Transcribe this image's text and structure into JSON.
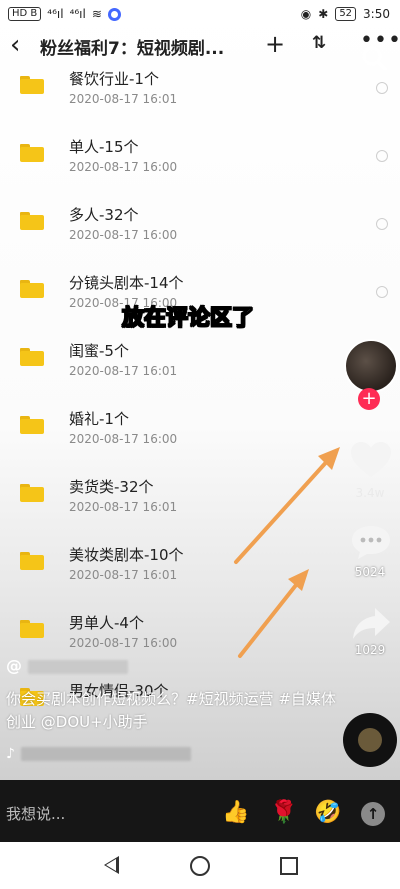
{
  "status_bar": {
    "left_items": [
      "HD B",
      "⁴⁶ıl",
      "⁴⁶ıl",
      "≋"
    ],
    "battery": "52",
    "time": "3:50"
  },
  "app_bar": {
    "title": "粉丝福利7：短视频剧...",
    "plus": "+",
    "sort": "⇅",
    "more": "•••"
  },
  "files": [
    {
      "name": "餐饮行业-1个",
      "date": "2020-08-17  16:01"
    },
    {
      "name": "单人-15个",
      "date": "2020-08-17  16:00"
    },
    {
      "name": "多人-32个",
      "date": "2020-08-17  16:00"
    },
    {
      "name": "分镜头剧本-14个",
      "date": "2020-08-17  16:00"
    },
    {
      "name": "闺蜜-5个",
      "date": "2020-08-17  16:01"
    },
    {
      "name": "婚礼-1个",
      "date": "2020-08-17  16:00"
    },
    {
      "name": "卖货类-32个",
      "date": "2020-08-17  16:01"
    },
    {
      "name": "美妆类剧本-10个",
      "date": "2020-08-17  16:01"
    },
    {
      "name": "男单人-4个",
      "date": "2020-08-17  16:00"
    },
    {
      "name": "男女情侣-30个",
      "date": ""
    }
  ],
  "overlay_caption": "放在评论区了",
  "rail": {
    "follow": "+",
    "like_count": "3.4w",
    "comment_count": "5024",
    "share_count": "1029"
  },
  "video_info": {
    "author_prefix": "@",
    "description": "你会买剧本创作短视频么？#短视频运营 #自媒体创业 @DOU+小助手",
    "music_prefix": "♪"
  },
  "comment_bar": {
    "placeholder": "我想说...",
    "emojis": [
      "👍",
      "🌹",
      "🤣"
    ],
    "send": "↑"
  },
  "colors": {
    "folder": "#f5c518",
    "follow_badge": "#fe2c55",
    "arrow": "#f0a050"
  }
}
